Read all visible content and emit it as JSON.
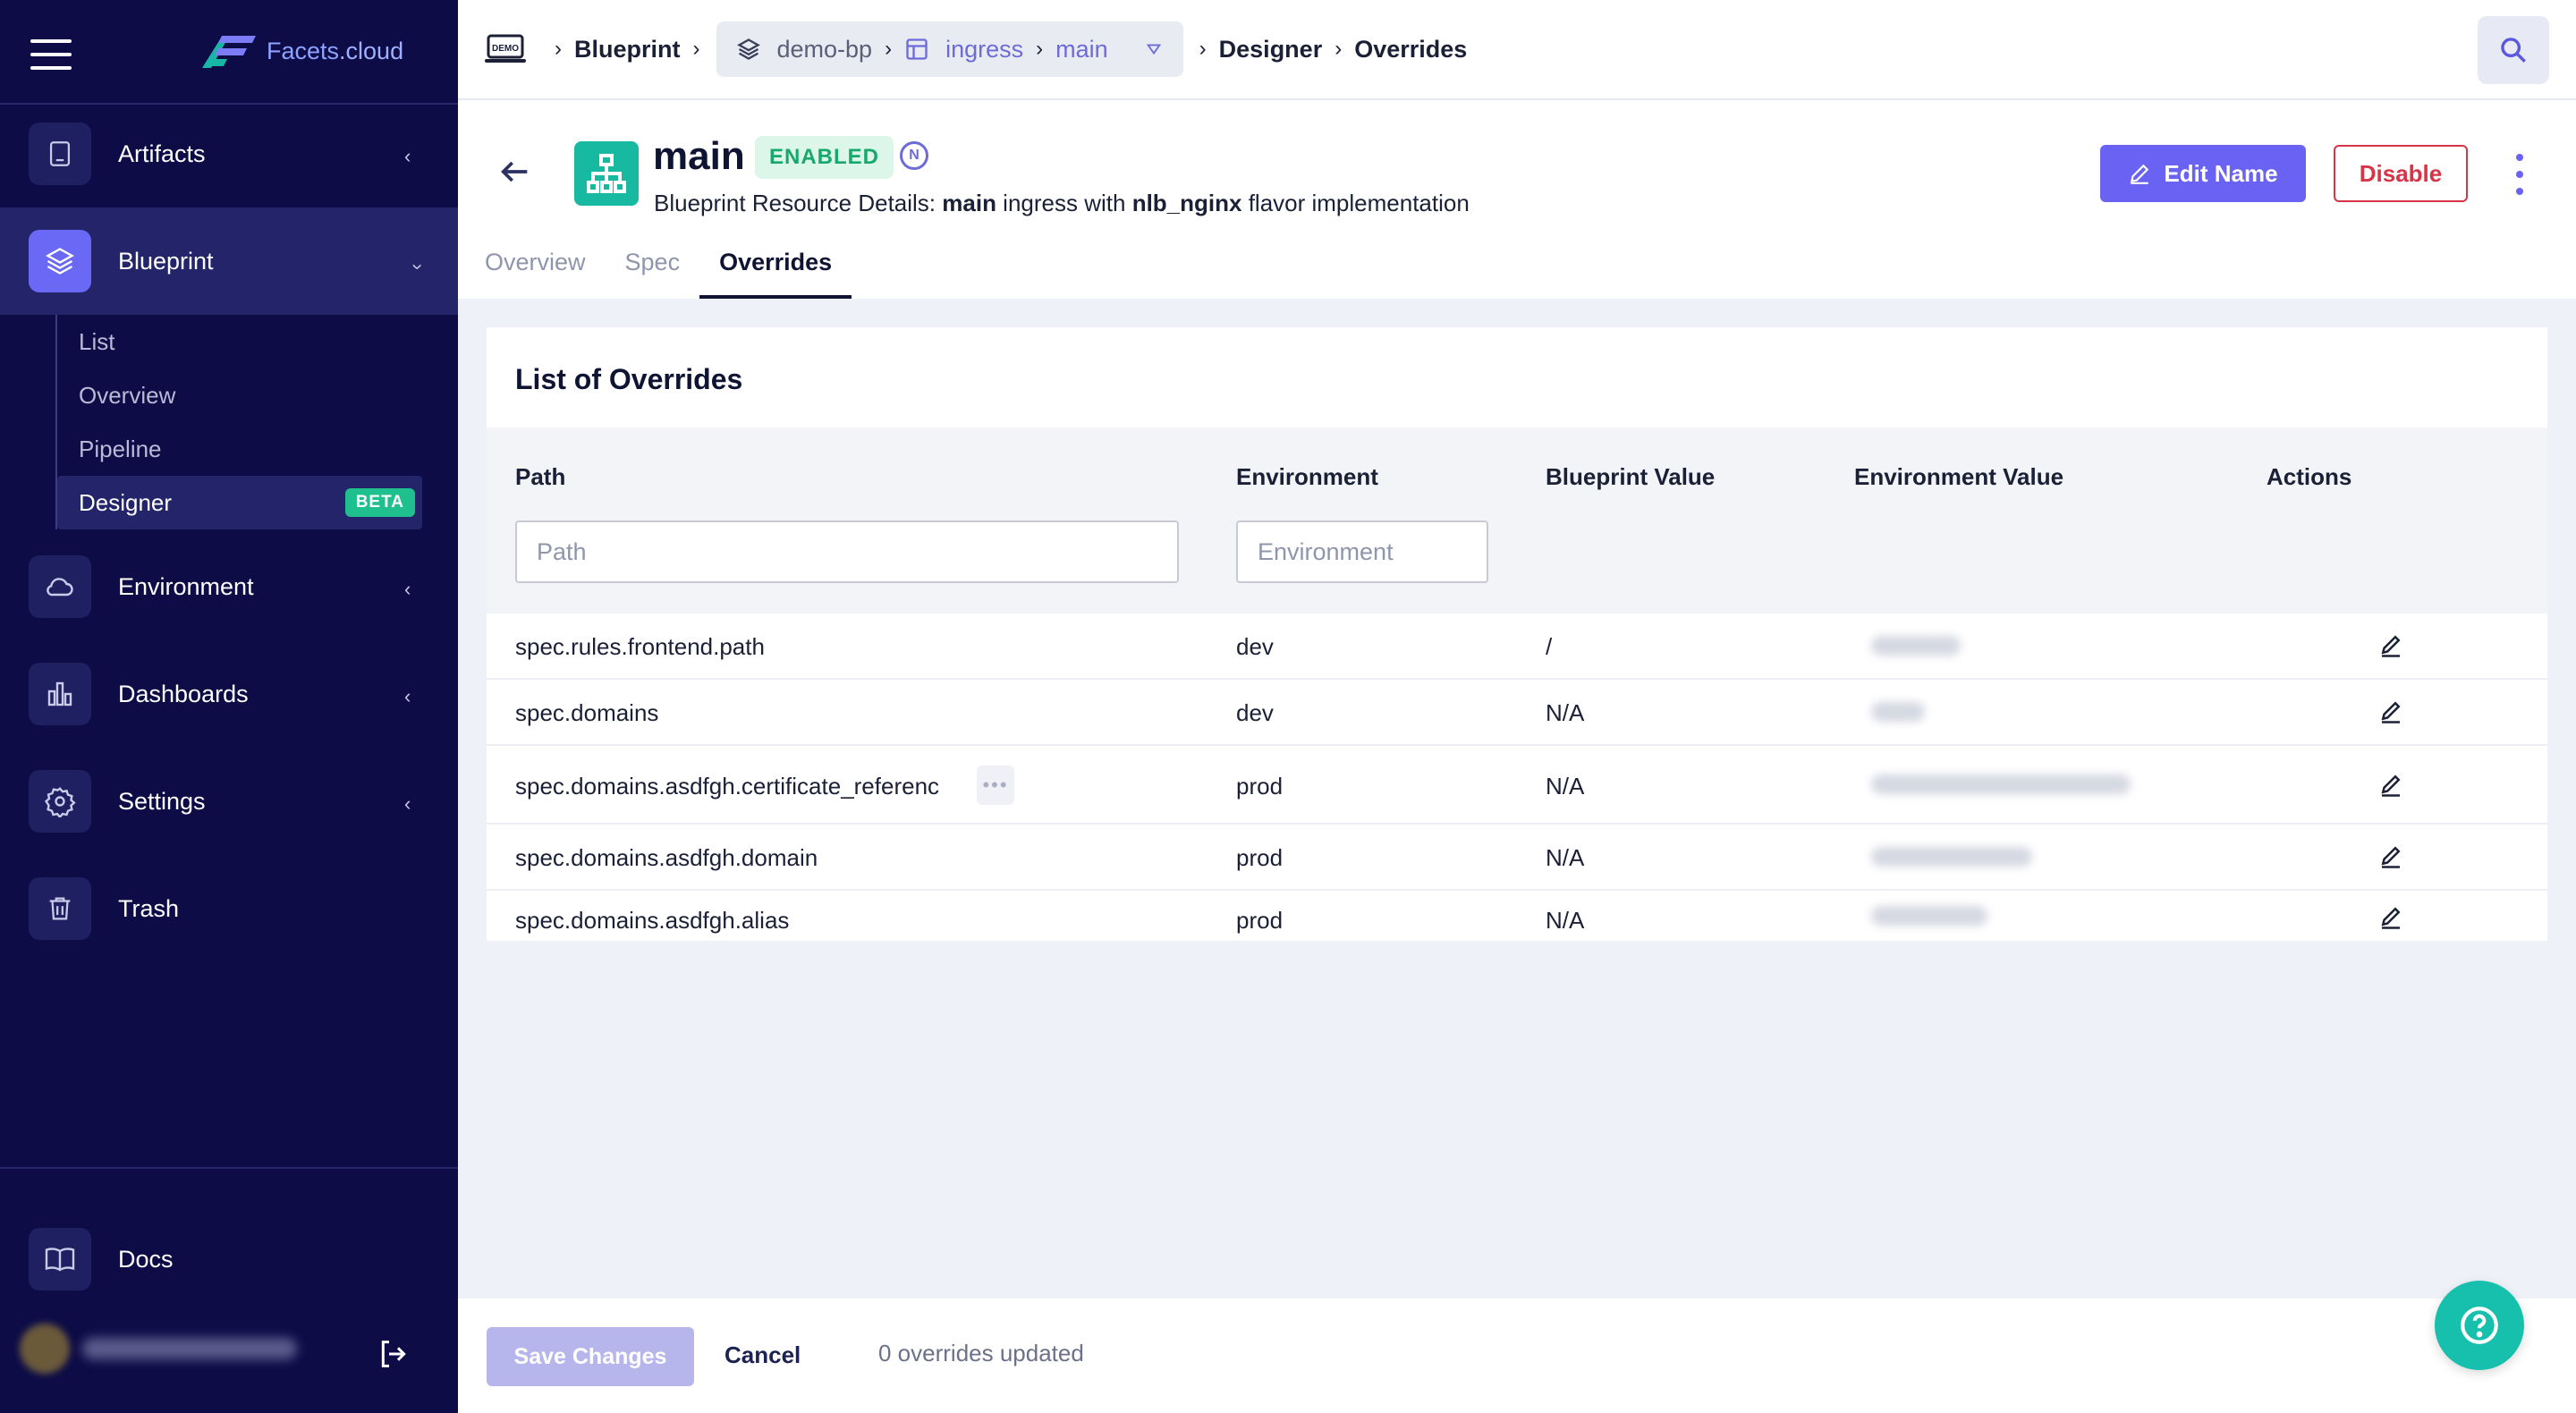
{
  "brand": {
    "logo_text_main": "Facets",
    "logo_text_suffix": ".cloud"
  },
  "sidebar": {
    "items": [
      {
        "label": "Artifacts",
        "icon": "tablet-icon"
      },
      {
        "label": "Blueprint",
        "icon": "layers-icon"
      },
      {
        "label": "Environment",
        "icon": "cloud-icon"
      },
      {
        "label": "Dashboards",
        "icon": "bar-chart-icon"
      },
      {
        "label": "Settings",
        "icon": "gear-icon"
      },
      {
        "label": "Trash",
        "icon": "trash-icon"
      }
    ],
    "blueprint_sub": [
      "List",
      "Overview",
      "Pipeline",
      "Designer"
    ],
    "beta_label": "BETA",
    "docs_label": "Docs"
  },
  "breadcrumb": {
    "demo_icon_text": "DEMO",
    "blueprint": "Blueprint",
    "project": "demo-bp",
    "resource_type": "ingress",
    "resource_name": "main",
    "designer": "Designer",
    "overrides": "Overrides"
  },
  "header": {
    "title": "main",
    "status": "ENABLED",
    "n_badge": "N",
    "subtitle_prefix": "Blueprint Resource Details: ",
    "subtitle_name": "main",
    "subtitle_mid": " ingress with ",
    "subtitle_flavor": "nlb_nginx",
    "subtitle_suffix": " flavor implementation",
    "edit_label": "Edit Name",
    "disable_label": "Disable"
  },
  "tabs": [
    "Overview",
    "Spec",
    "Overrides"
  ],
  "overrides": {
    "title": "List of Overrides",
    "columns": [
      "Path",
      "Environment",
      "Blueprint Value",
      "Environment Value",
      "Actions"
    ],
    "filters": {
      "path_placeholder": "Path",
      "env_placeholder": "Environment"
    },
    "rows": [
      {
        "path": "spec.rules.frontend.path",
        "env": "dev",
        "blueprint_value": "/"
      },
      {
        "path": "spec.domains",
        "env": "dev",
        "blueprint_value": "N/A"
      },
      {
        "path": "spec.domains.asdfgh.certificate_referenc",
        "env": "prod",
        "blueprint_value": "N/A"
      },
      {
        "path": "spec.domains.asdfgh.domain",
        "env": "prod",
        "blueprint_value": "N/A"
      },
      {
        "path": "spec.domains.asdfgh.alias",
        "env": "prod",
        "blueprint_value": "N/A"
      }
    ]
  },
  "footer": {
    "save_label": "Save Changes",
    "cancel_label": "Cancel",
    "status_text": "0 overrides updated"
  },
  "colors": {
    "sidebar_bg": "#0d0c47",
    "accent": "#6a62f3",
    "teal": "#17b9a0",
    "danger": "#d63447"
  }
}
